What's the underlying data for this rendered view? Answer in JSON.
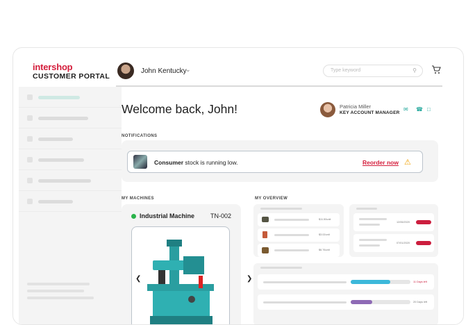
{
  "sidebar": {
    "brand": "intershop",
    "portal_title": "CUSTOMER PORTAL"
  },
  "topbar": {
    "user_name": "John Kentucky",
    "search_placeholder": "Type keyword"
  },
  "main": {
    "welcome": "Welcome back, John!"
  },
  "account_manager": {
    "name": "Patricia Miller",
    "role": "KEY ACCOUNT MANAGER"
  },
  "notifications": {
    "label": "NOTIFICATIONS",
    "item": {
      "bold": "Consumer",
      "text": " stock is running low.",
      "action": "Reorder now"
    }
  },
  "machines": {
    "label": "MY MACHINES",
    "name": "Industrial Machine",
    "code": "TN-002"
  },
  "overview": {
    "label": "MY OVERVIEW",
    "prices": [
      "$11.50unit",
      "$3.02unit",
      "$6.76unit"
    ],
    "dates": [
      "12/06/2020",
      "07/01/2020"
    ],
    "days": [
      "11 Days left",
      "20 Days left"
    ]
  },
  "colors": {
    "brand": "#d41e3c",
    "accent": "#1fa69a",
    "status_ok": "#2ab34a",
    "progress_blue": "#3cb8da",
    "progress_purple": "#8e6ab5",
    "badge_red": "#cc1e3e"
  },
  "progress": [
    0.66,
    0.36
  ]
}
